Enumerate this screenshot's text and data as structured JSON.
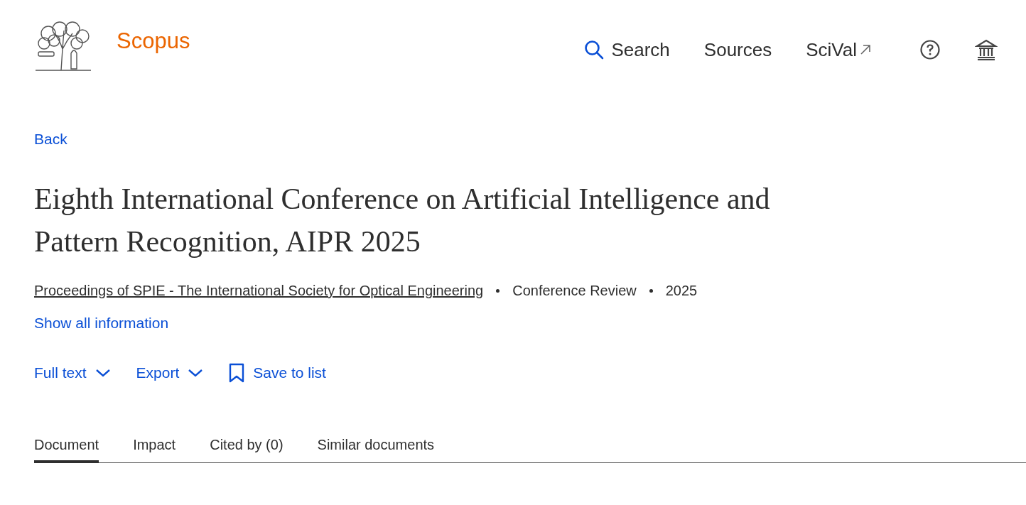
{
  "header": {
    "brand": "Scopus",
    "nav": [
      {
        "kind": "search",
        "label": "Search"
      },
      {
        "kind": "plain",
        "label": "Sources"
      },
      {
        "kind": "external",
        "label": "SciVal"
      }
    ]
  },
  "back": "Back",
  "title": "Eighth International Conference on Artificial Intelligence and Pattern Recognition, AIPR 2025",
  "meta": {
    "source": "Proceedings of SPIE - The International Society for Optical Engineering",
    "details": [
      "Conference Review",
      "2025"
    ]
  },
  "show_all": "Show all information",
  "actions": [
    {
      "kind": "dropdown",
      "label": "Full text"
    },
    {
      "kind": "dropdown",
      "label": "Export"
    },
    {
      "kind": "bookmark",
      "label": "Save to list"
    }
  ],
  "tabs": [
    {
      "label": "Document",
      "selected": true
    },
    {
      "label": "Impact",
      "selected": false
    },
    {
      "label": "Cited by (0)",
      "selected": false
    },
    {
      "label": "Similar documents",
      "selected": false
    }
  ]
}
